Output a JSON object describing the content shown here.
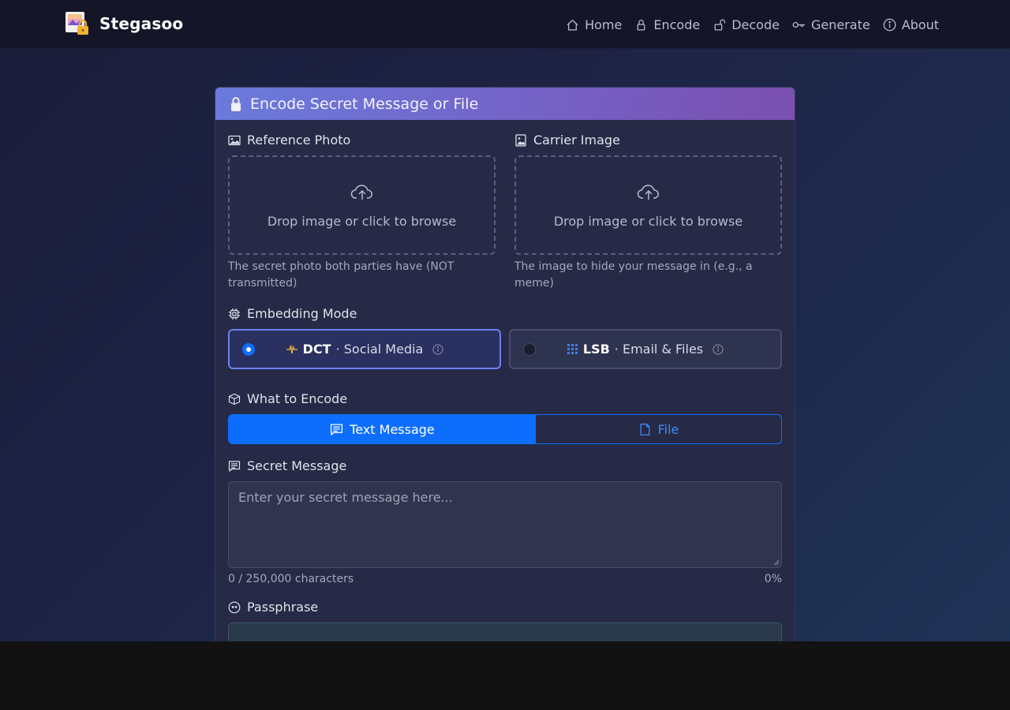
{
  "app": {
    "name": "Stegasoo"
  },
  "nav": [
    {
      "label": "Home",
      "icon": "home-icon"
    },
    {
      "label": "Encode",
      "icon": "lock-icon"
    },
    {
      "label": "Decode",
      "icon": "unlock-icon"
    },
    {
      "label": "Generate",
      "icon": "key-icon"
    },
    {
      "label": "About",
      "icon": "info-icon"
    }
  ],
  "card": {
    "title": "Encode Secret Message or File"
  },
  "reference": {
    "label": "Reference Photo",
    "drop_text": "Drop image or click to browse",
    "help": "The secret photo both parties have (NOT transmitted)"
  },
  "carrier": {
    "label": "Carrier Image",
    "drop_text": "Drop image or click to browse",
    "help": "The image to hide your message in (e.g., a meme)"
  },
  "embedding": {
    "label": "Embedding Mode",
    "options": [
      {
        "code": "DCT",
        "desc": "· Social Media",
        "selected": true
      },
      {
        "code": "LSB",
        "desc": "· Email & Files",
        "selected": false
      }
    ]
  },
  "what": {
    "label": "What to Encode",
    "tabs": [
      {
        "label": "Text Message",
        "active": true
      },
      {
        "label": "File",
        "active": false
      }
    ]
  },
  "message": {
    "label": "Secret Message",
    "placeholder": "Enter your secret message here...",
    "counter": "0 / 250,000 characters",
    "percent": "0%"
  },
  "passphrase": {
    "label": "Passphrase"
  },
  "colors": {
    "primary": "#0d6efd",
    "header_start": "#6a7bdc",
    "header_end": "#7a4fb0"
  }
}
